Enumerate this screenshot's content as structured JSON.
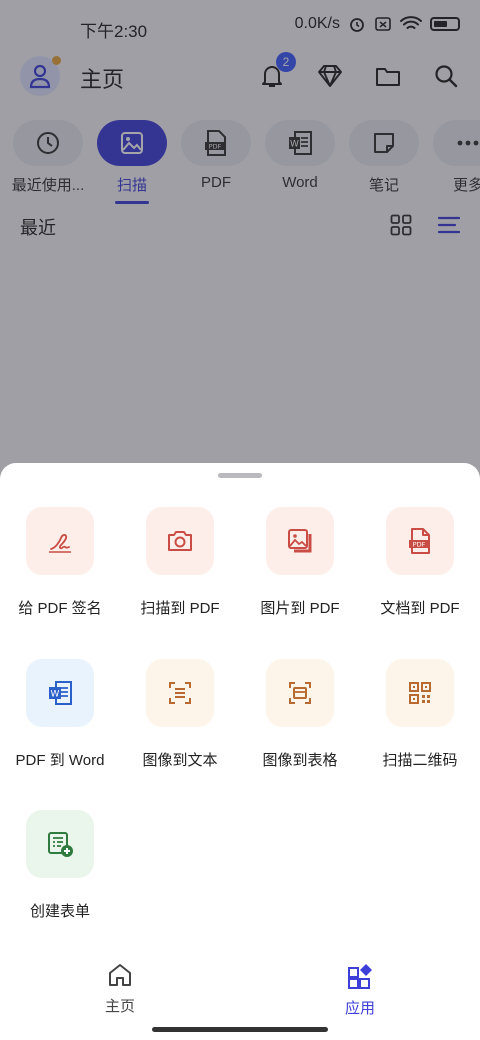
{
  "status_bar": {
    "time": "下午2:30",
    "network_speed": "0.0K/s"
  },
  "app_bar": {
    "title": "主页",
    "notification_count": "2"
  },
  "chips": [
    {
      "label": "最近使用...",
      "icon": "clock-icon"
    },
    {
      "label": "扫描",
      "icon": "image-icon"
    },
    {
      "label": "PDF",
      "icon": "pdf-file-icon"
    },
    {
      "label": "Word",
      "icon": "word-file-icon"
    },
    {
      "label": "笔记",
      "icon": "note-icon"
    },
    {
      "label": "更多",
      "icon": "more-icon"
    }
  ],
  "recent_label": "最近",
  "sheet": {
    "items": [
      {
        "label": "给 PDF 签名",
        "icon": "signature-icon",
        "bg": "#fdeee9",
        "color": "#c94d45"
      },
      {
        "label": "扫描到 PDF",
        "icon": "camera-icon",
        "bg": "#fdeee9",
        "color": "#c94d45"
      },
      {
        "label": "图片到 PDF",
        "icon": "images-icon",
        "bg": "#fdeee9",
        "color": "#c94d45"
      },
      {
        "label": "文档到 PDF",
        "icon": "pdf-doc-icon",
        "bg": "#fdeee9",
        "color": "#c94d45"
      },
      {
        "label": "PDF 到 Word",
        "icon": "word-icon",
        "bg": "#e9f3fd",
        "color": "#2b5fc9"
      },
      {
        "label": "图像到文本",
        "icon": "ocr-text-icon",
        "bg": "#fdf5ea",
        "color": "#b86a30"
      },
      {
        "label": "图像到表格",
        "icon": "ocr-table-icon",
        "bg": "#fdf5ea",
        "color": "#b86a30"
      },
      {
        "label": "扫描二维码",
        "icon": "qr-code-icon",
        "bg": "#fdf5ea",
        "color": "#b86a30"
      },
      {
        "label": "创建表单",
        "icon": "form-add-icon",
        "bg": "#eaf6ec",
        "color": "#2f7a3f"
      }
    ]
  },
  "bottom_nav": [
    {
      "label": "主页",
      "icon": "home-icon",
      "active": false
    },
    {
      "label": "应用",
      "icon": "apps-icon",
      "active": true
    }
  ],
  "colors": {
    "accent": "#3d3fd8",
    "scrim": "rgba(40,40,50,0.42)"
  }
}
